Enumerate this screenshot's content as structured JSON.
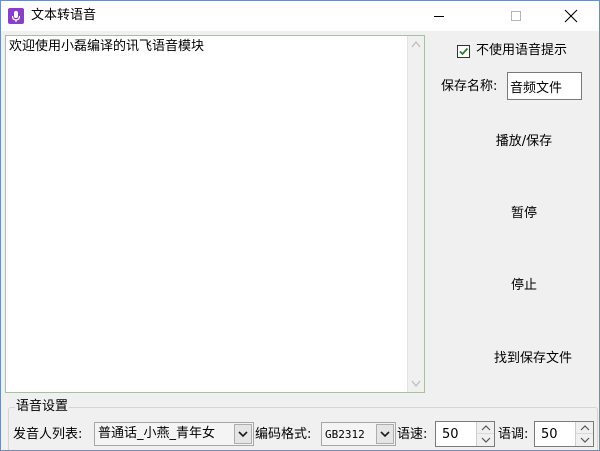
{
  "window": {
    "title": "文本转语音"
  },
  "editor": {
    "text": "欢迎使用小磊编译的讯飞语音模块"
  },
  "options": {
    "no_voice_prompt_label": "不使用语音提示",
    "no_voice_prompt_checked": true,
    "save_name_label": "保存名称:",
    "save_name_value": "音频文件"
  },
  "actions": {
    "play_save": "播放/保存",
    "pause": "暂停",
    "stop": "停止",
    "find_saved_file": "找到保存文件"
  },
  "voice_settings": {
    "group_title": "语音设置",
    "speaker_label": "发音人列表:",
    "speaker_value": "普通话_小燕_青年女",
    "encoding_label": "编码格式:",
    "encoding_value": "GB2312",
    "speed_label": "语速:",
    "speed_value": "50",
    "pitch_label": "语调:",
    "pitch_value": "50"
  },
  "colors": {
    "app_icon": "#8a3fc7",
    "checkmark": "#2e7d32",
    "editor_border": "#a9c0a0"
  },
  "icons": {
    "app": "microphone-icon",
    "minimize": "minimize-icon",
    "maximize": "maximize-icon",
    "close": "close-icon",
    "dropdown": "chevron-down-icon"
  }
}
